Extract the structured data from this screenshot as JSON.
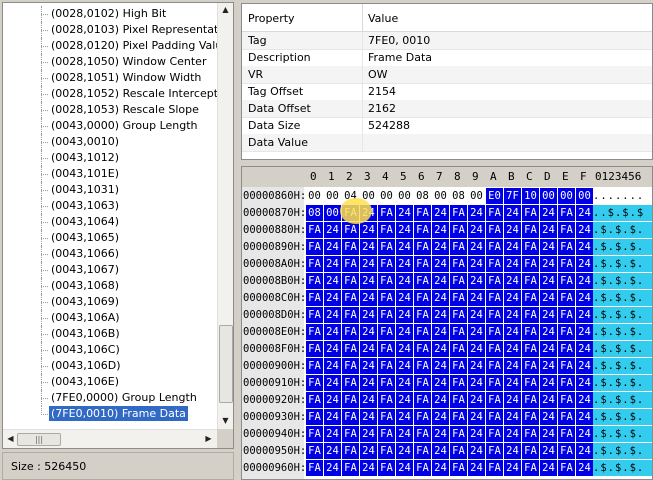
{
  "tree": {
    "items": [
      {
        "tag": "(0028,0102)",
        "name": "High Bit"
      },
      {
        "tag": "(0028,0103)",
        "name": "Pixel Representation"
      },
      {
        "tag": "(0028,0120)",
        "name": "Pixel Padding Value"
      },
      {
        "tag": "(0028,1050)",
        "name": "Window Center"
      },
      {
        "tag": "(0028,1051)",
        "name": "Window Width"
      },
      {
        "tag": "(0028,1052)",
        "name": "Rescale Intercept"
      },
      {
        "tag": "(0028,1053)",
        "name": "Rescale Slope"
      },
      {
        "tag": "(0043,0000)",
        "name": "Group Length"
      },
      {
        "tag": "(0043,0010)",
        "name": ""
      },
      {
        "tag": "(0043,1012)",
        "name": ""
      },
      {
        "tag": "(0043,101E)",
        "name": ""
      },
      {
        "tag": "(0043,1031)",
        "name": ""
      },
      {
        "tag": "(0043,1063)",
        "name": ""
      },
      {
        "tag": "(0043,1064)",
        "name": ""
      },
      {
        "tag": "(0043,1065)",
        "name": ""
      },
      {
        "tag": "(0043,1066)",
        "name": ""
      },
      {
        "tag": "(0043,1067)",
        "name": ""
      },
      {
        "tag": "(0043,1068)",
        "name": ""
      },
      {
        "tag": "(0043,1069)",
        "name": ""
      },
      {
        "tag": "(0043,106A)",
        "name": ""
      },
      {
        "tag": "(0043,106B)",
        "name": ""
      },
      {
        "tag": "(0043,106C)",
        "name": ""
      },
      {
        "tag": "(0043,106D)",
        "name": ""
      },
      {
        "tag": "(0043,106E)",
        "name": ""
      },
      {
        "tag": "(7FE0,0000)",
        "name": "Group Length"
      },
      {
        "tag": "(7FE0,0010)",
        "name": "Frame Data",
        "selected": true
      }
    ],
    "vscroll_position": 0.78
  },
  "status": {
    "size_text": "Size : 526450"
  },
  "properties": {
    "col_property": "Property",
    "col_value": "Value",
    "rows": [
      {
        "key": "Tag",
        "value": "7FE0, 0010"
      },
      {
        "key": "Description",
        "value": "Frame Data"
      },
      {
        "key": "VR",
        "value": "OW"
      },
      {
        "key": "Tag Offset",
        "value": "2154"
      },
      {
        "key": "Data Offset",
        "value": "2162"
      },
      {
        "key": "Data Size",
        "value": "524288"
      },
      {
        "key": "Data Value",
        "value": ""
      }
    ]
  },
  "hex": {
    "columns": [
      "0",
      "1",
      "2",
      "3",
      "4",
      "5",
      "6",
      "7",
      "8",
      "9",
      "A",
      "B",
      "C",
      "D",
      "E",
      "F"
    ],
    "ascii_header": "0123456",
    "rows": [
      {
        "addr": "00000860H:",
        "bytes": [
          "00",
          "00",
          "04",
          "00",
          "00",
          "00",
          "08",
          "00",
          "08",
          "00",
          "E0",
          "7F",
          "10",
          "00",
          "00",
          "00"
        ],
        "ascii": "......."
      },
      {
        "addr": "00000870H:",
        "bytes": [
          "08",
          "00",
          "FA",
          "24",
          "FA",
          "24",
          "FA",
          "24",
          "FA",
          "24",
          "FA",
          "24",
          "FA",
          "24",
          "FA",
          "24"
        ],
        "ascii": "..$.$.$"
      },
      {
        "addr": "00000880H:",
        "bytes": [
          "FA",
          "24",
          "FA",
          "24",
          "FA",
          "24",
          "FA",
          "24",
          "FA",
          "24",
          "FA",
          "24",
          "FA",
          "24",
          "FA",
          "24"
        ],
        "ascii": ".$.$.$."
      },
      {
        "addr": "00000890H:",
        "bytes": [
          "FA",
          "24",
          "FA",
          "24",
          "FA",
          "24",
          "FA",
          "24",
          "FA",
          "24",
          "FA",
          "24",
          "FA",
          "24",
          "FA",
          "24"
        ],
        "ascii": ".$.$.$."
      },
      {
        "addr": "000008A0H:",
        "bytes": [
          "FA",
          "24",
          "FA",
          "24",
          "FA",
          "24",
          "FA",
          "24",
          "FA",
          "24",
          "FA",
          "24",
          "FA",
          "24",
          "FA",
          "24"
        ],
        "ascii": ".$.$.$."
      },
      {
        "addr": "000008B0H:",
        "bytes": [
          "FA",
          "24",
          "FA",
          "24",
          "FA",
          "24",
          "FA",
          "24",
          "FA",
          "24",
          "FA",
          "24",
          "FA",
          "24",
          "FA",
          "24"
        ],
        "ascii": ".$.$.$."
      },
      {
        "addr": "000008C0H:",
        "bytes": [
          "FA",
          "24",
          "FA",
          "24",
          "FA",
          "24",
          "FA",
          "24",
          "FA",
          "24",
          "FA",
          "24",
          "FA",
          "24",
          "FA",
          "24"
        ],
        "ascii": ".$.$.$."
      },
      {
        "addr": "000008D0H:",
        "bytes": [
          "FA",
          "24",
          "FA",
          "24",
          "FA",
          "24",
          "FA",
          "24",
          "FA",
          "24",
          "FA",
          "24",
          "FA",
          "24",
          "FA",
          "24"
        ],
        "ascii": ".$.$.$."
      },
      {
        "addr": "000008E0H:",
        "bytes": [
          "FA",
          "24",
          "FA",
          "24",
          "FA",
          "24",
          "FA",
          "24",
          "FA",
          "24",
          "FA",
          "24",
          "FA",
          "24",
          "FA",
          "24"
        ],
        "ascii": ".$.$.$."
      },
      {
        "addr": "000008F0H:",
        "bytes": [
          "FA",
          "24",
          "FA",
          "24",
          "FA",
          "24",
          "FA",
          "24",
          "FA",
          "24",
          "FA",
          "24",
          "FA",
          "24",
          "FA",
          "24"
        ],
        "ascii": ".$.$.$."
      },
      {
        "addr": "00000900H:",
        "bytes": [
          "FA",
          "24",
          "FA",
          "24",
          "FA",
          "24",
          "FA",
          "24",
          "FA",
          "24",
          "FA",
          "24",
          "FA",
          "24",
          "FA",
          "24"
        ],
        "ascii": ".$.$.$."
      },
      {
        "addr": "00000910H:",
        "bytes": [
          "FA",
          "24",
          "FA",
          "24",
          "FA",
          "24",
          "FA",
          "24",
          "FA",
          "24",
          "FA",
          "24",
          "FA",
          "24",
          "FA",
          "24"
        ],
        "ascii": ".$.$.$."
      },
      {
        "addr": "00000920H:",
        "bytes": [
          "FA",
          "24",
          "FA",
          "24",
          "FA",
          "24",
          "FA",
          "24",
          "FA",
          "24",
          "FA",
          "24",
          "FA",
          "24",
          "FA",
          "24"
        ],
        "ascii": ".$.$.$."
      },
      {
        "addr": "00000930H:",
        "bytes": [
          "FA",
          "24",
          "FA",
          "24",
          "FA",
          "24",
          "FA",
          "24",
          "FA",
          "24",
          "FA",
          "24",
          "FA",
          "24",
          "FA",
          "24"
        ],
        "ascii": ".$.$.$."
      },
      {
        "addr": "00000940H:",
        "bytes": [
          "FA",
          "24",
          "FA",
          "24",
          "FA",
          "24",
          "FA",
          "24",
          "FA",
          "24",
          "FA",
          "24",
          "FA",
          "24",
          "FA",
          "24"
        ],
        "ascii": ".$.$.$."
      },
      {
        "addr": "00000950H:",
        "bytes": [
          "FA",
          "24",
          "FA",
          "24",
          "FA",
          "24",
          "FA",
          "24",
          "FA",
          "24",
          "FA",
          "24",
          "FA",
          "24",
          "FA",
          "24"
        ],
        "ascii": ".$.$.$."
      },
      {
        "addr": "00000960H:",
        "bytes": [
          "FA",
          "24",
          "FA",
          "24",
          "FA",
          "24",
          "FA",
          "24",
          "FA",
          "24",
          "FA",
          "24",
          "FA",
          "24",
          "FA",
          "24"
        ],
        "ascii": ".$.$.$."
      }
    ],
    "selected_range": {
      "row": 0,
      "from_col": 10
    },
    "colors": {
      "selection": "#0000e6",
      "selected_text": "#ffffff",
      "ascii_selection": "#33ccee",
      "highlight_cell": "#ffe14a"
    }
  }
}
